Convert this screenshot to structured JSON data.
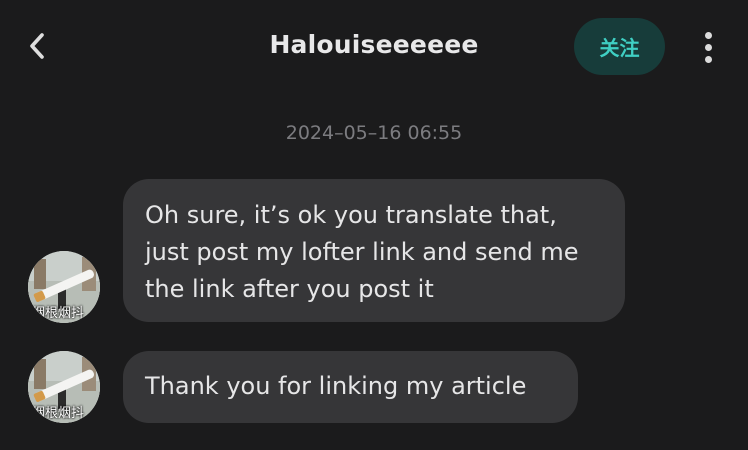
{
  "header": {
    "back_icon": "chevron-left-icon",
    "title": "Halouiseeeeee",
    "follow_label": "关注",
    "more_icon": "vertical-dots-icon",
    "follow_bg": "#173c3a",
    "follow_color": "#3fcfc3"
  },
  "chat": {
    "timestamp": "2024–05–16 06:55",
    "messages": [
      {
        "sender_avatar_text": "烟根烟抖",
        "lines": [
          "Oh sure, it’s ok you translate that,",
          "just post my lofter link and send me",
          "the link after you post it"
        ]
      },
      {
        "sender_avatar_text": "烟根烟抖",
        "lines": [
          "Thank you for linking my article"
        ]
      }
    ]
  },
  "colors": {
    "background": "#1b1b1c",
    "bubble": "#363638",
    "timestamp": "#7c7c80"
  }
}
